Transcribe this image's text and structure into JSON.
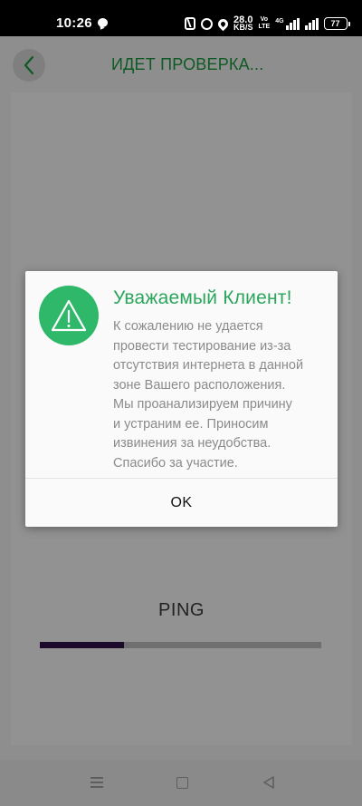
{
  "status_bar": {
    "time": "10:26",
    "net_speed_value": "28.0",
    "net_speed_unit": "KB/S",
    "volte_top": "Vo",
    "volte_bottom": "LTE",
    "network_type": "4G",
    "battery_level": "77"
  },
  "app_bar": {
    "title": "ИДЕТ ПРОВЕРКА..."
  },
  "test_panel": {
    "ping_label": "PING",
    "progress_fraction": 0.3
  },
  "dialog": {
    "title": "Уважаемый Клиент!",
    "message": "К сожалению не удается\nпровести тестирование из-за\nотсутствия интернета в данной\nзоне Вашего расположения.\nМы проанализируем причину\nи устраним ее. Приносим\nизвинения за неудобства.\nСпасибо за участие.",
    "ok_label": "OK"
  },
  "icons": {
    "back": "chevron-left-icon",
    "warning": "warning-triangle-icon",
    "nav_menu": "menu-icon",
    "nav_home": "home-icon",
    "nav_back": "back-triangle-icon"
  },
  "colors": {
    "accent_green": "#2fb86a",
    "title_green": "#2aa55b",
    "progress_fill": "#1b0a2c"
  }
}
